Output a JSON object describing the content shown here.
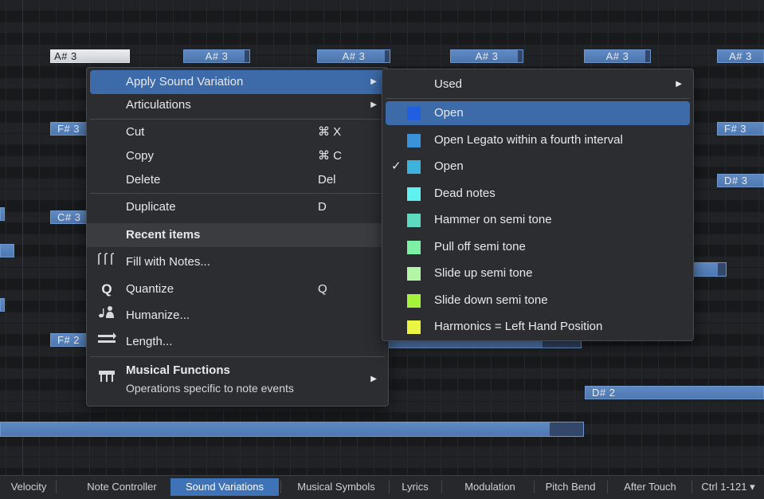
{
  "piano_roll": {
    "notes": [
      {
        "label": "A# 3"
      },
      {
        "label": "A# 3"
      },
      {
        "label": "A# 3"
      },
      {
        "label": "A# 3"
      },
      {
        "label": "A# 3"
      },
      {
        "label": "A# 3"
      },
      {
        "label": "F# 3"
      },
      {
        "label": "F# 3"
      },
      {
        "label": "D# 3"
      },
      {
        "label": "C# 3"
      },
      {
        "label": "F# 2"
      },
      {
        "label": "D# 2"
      }
    ]
  },
  "context_menu": {
    "apply_sound_variation": "Apply Sound Variation",
    "articulations": "Articulations",
    "cut": "Cut",
    "cut_shortcut": "⌘ X",
    "copy": "Copy",
    "copy_shortcut": "⌘ C",
    "delete": "Delete",
    "delete_shortcut": "Del",
    "duplicate": "Duplicate",
    "duplicate_shortcut": "D",
    "recent_items": "Recent items",
    "fill_with_notes": "Fill with Notes...",
    "quantize": "Quantize",
    "quantize_shortcut": "Q",
    "humanize": "Humanize...",
    "length": "Length...",
    "musical_functions": "Musical Functions",
    "musical_functions_sub": "Operations specific to note events"
  },
  "submenu": {
    "used": "Used",
    "items": [
      {
        "label": "Open",
        "color": "#1f5fe0",
        "checked": false,
        "highlighted": true
      },
      {
        "label": "Open Legato within a fourth interval",
        "color": "#3a93d8",
        "checked": false,
        "highlighted": false
      },
      {
        "label": "Open",
        "color": "#3cb2dc",
        "checked": true,
        "highlighted": false
      },
      {
        "label": "Dead notes",
        "color": "#5ff0f0",
        "checked": false,
        "highlighted": false
      },
      {
        "label": "Hammer on semi tone",
        "color": "#5ed9c2",
        "checked": false,
        "highlighted": false
      },
      {
        "label": "Pull off semi tone",
        "color": "#7ef0a6",
        "checked": false,
        "highlighted": false
      },
      {
        "label": "Slide up semi tone",
        "color": "#b3f7a6",
        "checked": false,
        "highlighted": false
      },
      {
        "label": "Slide down semi tone",
        "color": "#a6f23c",
        "checked": false,
        "highlighted": false
      },
      {
        "label": "Harmonics = Left Hand Position",
        "color": "#e9f542",
        "checked": false,
        "highlighted": false
      }
    ],
    "check_glyph": "✓"
  },
  "tabs": {
    "items": [
      "Velocity",
      "Note Controller",
      "Sound Variations",
      "Musical Symbols",
      "Lyrics",
      "Modulation",
      "Pitch Bend",
      "After Touch",
      "Ctrl 1-121 ▾"
    ],
    "active": "Sound Variations"
  },
  "colors": {
    "accent": "#3d6aa8",
    "note": "#5680bb",
    "tab_active": "#3f73b8"
  }
}
